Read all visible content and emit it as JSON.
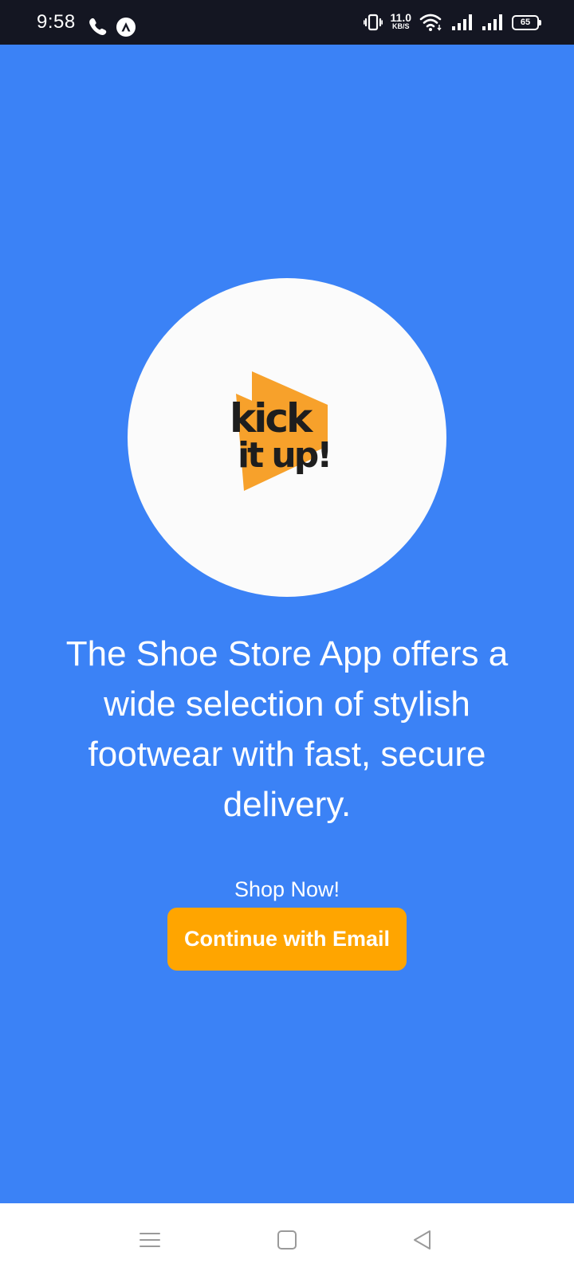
{
  "status_bar": {
    "time": "9:58",
    "left_icons": [
      "phone-icon",
      "app-notification-icon"
    ],
    "network_speed_value": "11.0",
    "network_speed_unit": "KB/S",
    "battery_level": "65",
    "right_icons": [
      "vibrate-icon",
      "wifi-icon",
      "signal-icon",
      "signal-icon"
    ]
  },
  "logo": {
    "text_line1": "kick",
    "text_line2": "it up!",
    "brand_color": "#f7a12b"
  },
  "main": {
    "description": "The Shoe Store App offers a wide selection of stylish footwear with fast, secure delivery.",
    "shop_now_label": "Shop Now!",
    "continue_button_label": "Continue with Email"
  },
  "colors": {
    "background": "#3b82f6",
    "button": "#ffa500",
    "status_bar": "#141622"
  },
  "nav_bar": {
    "icons": [
      "menu-icon",
      "home-square-icon",
      "back-triangle-icon"
    ]
  }
}
